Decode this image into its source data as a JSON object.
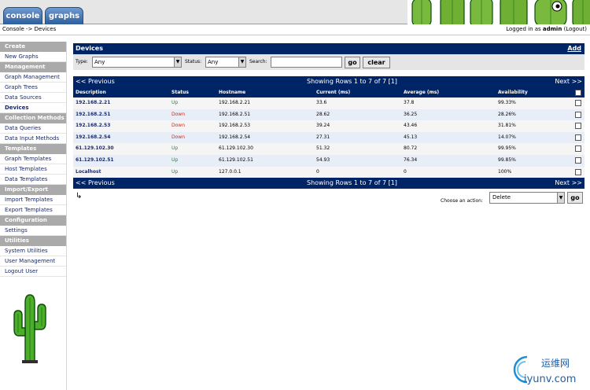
{
  "tabs": {
    "console": "console",
    "graphs": "graphs"
  },
  "breadcrumb": "Console -> Devices",
  "login": {
    "prefix": "Logged in as",
    "user": "admin",
    "logout": "(Logout)"
  },
  "sidebar": [
    {
      "type": "head",
      "label": "Create"
    },
    {
      "type": "item",
      "label": "New Graphs"
    },
    {
      "type": "head",
      "label": "Management"
    },
    {
      "type": "item",
      "label": "Graph Management"
    },
    {
      "type": "item",
      "label": "Graph Trees"
    },
    {
      "type": "item",
      "label": "Data Sources"
    },
    {
      "type": "item",
      "label": "Devices",
      "active": true
    },
    {
      "type": "head",
      "label": "Collection Methods"
    },
    {
      "type": "item",
      "label": "Data Queries"
    },
    {
      "type": "item",
      "label": "Data Input Methods"
    },
    {
      "type": "head",
      "label": "Templates"
    },
    {
      "type": "item",
      "label": "Graph Templates"
    },
    {
      "type": "item",
      "label": "Host Templates"
    },
    {
      "type": "item",
      "label": "Data Templates"
    },
    {
      "type": "head",
      "label": "Import/Export"
    },
    {
      "type": "item",
      "label": "Import Templates"
    },
    {
      "type": "item",
      "label": "Export Templates"
    },
    {
      "type": "head",
      "label": "Configuration"
    },
    {
      "type": "item",
      "label": "Settings"
    },
    {
      "type": "head",
      "label": "Utilities"
    },
    {
      "type": "item",
      "label": "System Utilities"
    },
    {
      "type": "item",
      "label": "User Management"
    },
    {
      "type": "item",
      "label": "Logout User"
    }
  ],
  "devices": {
    "title": "Devices",
    "add": "Add",
    "filter": {
      "type_label": "Type:",
      "type_value": "Any",
      "status_label": "Status:",
      "status_value": "Any",
      "search_label": "Search:",
      "search_value": "",
      "go": "go",
      "clear": "clear"
    },
    "nav": {
      "prev": "<< Previous",
      "showing": "Showing Rows 1 to 7 of 7",
      "page": "[1]",
      "next": "Next >>"
    },
    "columns": [
      "Description",
      "Status",
      "Hostname",
      "Current (ms)",
      "Average (ms)",
      "Availability"
    ],
    "rows": [
      {
        "desc": "192.168.2.21",
        "status": "Up",
        "host": "192.168.2.21",
        "cur": "33.6",
        "avg": "37.8",
        "avail": "99.33%"
      },
      {
        "desc": "192.168.2.51",
        "status": "Down",
        "host": "192.168.2.51",
        "cur": "28.62",
        "avg": "36.25",
        "avail": "28.26%"
      },
      {
        "desc": "192.168.2.53",
        "status": "Down",
        "host": "192.168.2.53",
        "cur": "39.24",
        "avg": "43.46",
        "avail": "31.81%"
      },
      {
        "desc": "192.168.2.54",
        "status": "Down",
        "host": "192.168.2.54",
        "cur": "27.31",
        "avg": "45.13",
        "avail": "14.07%"
      },
      {
        "desc": "61.129.102.30",
        "status": "Up",
        "host": "61.129.102.30",
        "cur": "51.32",
        "avg": "80.72",
        "avail": "99.95%"
      },
      {
        "desc": "61.129.102.51",
        "status": "Up",
        "host": "61.129.102.51",
        "cur": "54.93",
        "avg": "76.34",
        "avail": "99.85%"
      },
      {
        "desc": "Localhost",
        "status": "Up",
        "host": "127.0.0.1",
        "cur": "0",
        "avg": "0",
        "avail": "100%"
      }
    ],
    "action_label": "Choose an action:",
    "action_value": "Delete",
    "action_go": "go",
    "arrow_glyph": "↳"
  },
  "watermark": {
    "cn": "运维网",
    "url": "iyunv.com"
  },
  "colors": {
    "header_blue": "#002566",
    "up": "#198e32",
    "down": "#c62d1f",
    "sidebar_head": "#aaaaaa"
  }
}
